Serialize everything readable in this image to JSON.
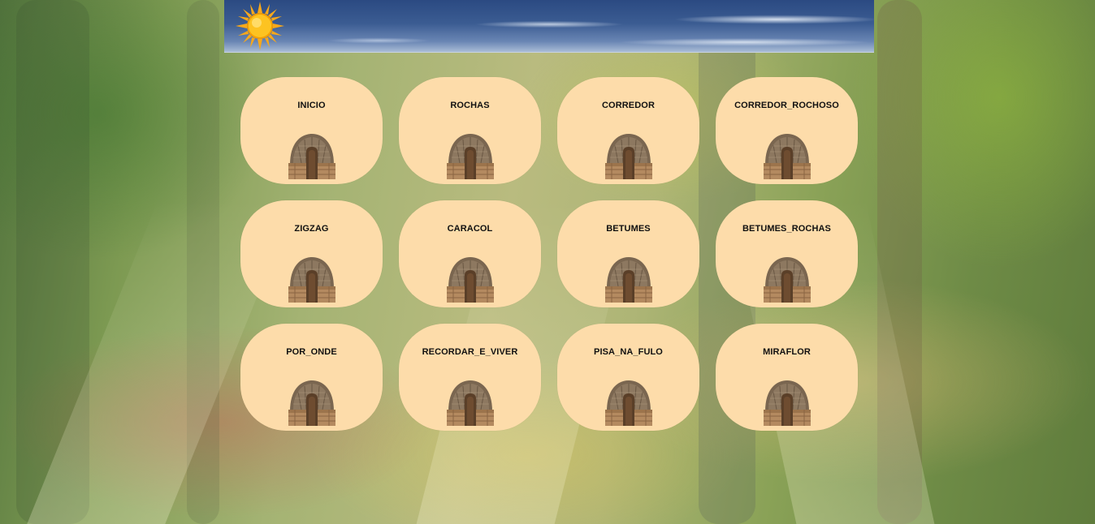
{
  "banner": {
    "sun_icon": "sun-icon"
  },
  "tracks": [
    {
      "label": "INICIO",
      "icon": "hut-icon"
    },
    {
      "label": "ROCHAS",
      "icon": "hut-icon"
    },
    {
      "label": "CORREDOR",
      "icon": "hut-icon"
    },
    {
      "label": "CORREDOR_ROCHOSO",
      "icon": "hut-icon"
    },
    {
      "label": "ZIGZAG",
      "icon": "hut-icon"
    },
    {
      "label": "CARACOL",
      "icon": "hut-icon"
    },
    {
      "label": "BETUMES",
      "icon": "hut-icon"
    },
    {
      "label": "BETUMES_ROCHAS",
      "icon": "hut-icon"
    },
    {
      "label": "POR_ONDE",
      "icon": "hut-icon"
    },
    {
      "label": "RECORDAR_E_VIVER",
      "icon": "hut-icon"
    },
    {
      "label": "PISA_NA_FULO",
      "icon": "hut-icon"
    },
    {
      "label": "MIRAFLOR",
      "icon": "hut-icon"
    }
  ],
  "colors": {
    "card_background": "#fddcaa",
    "card_text": "#111111",
    "sky_top": "#2b4a82",
    "sun": "#f9b712"
  }
}
